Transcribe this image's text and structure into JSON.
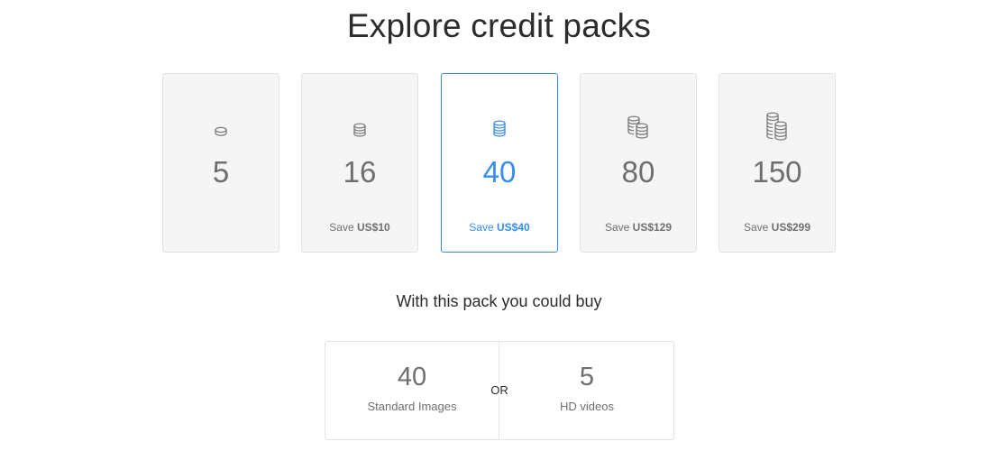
{
  "title": "Explore credit packs",
  "packs": [
    {
      "credits": "5",
      "save_prefix": "",
      "save_amount": "",
      "icon": "single-coin-icon",
      "selected": false
    },
    {
      "credits": "16",
      "save_prefix": "Save ",
      "save_amount": "US$10",
      "icon": "small-coin-stack-icon",
      "selected": false
    },
    {
      "credits": "40",
      "save_prefix": "Save ",
      "save_amount": "US$40",
      "icon": "coin-stack-icon",
      "selected": true
    },
    {
      "credits": "80",
      "save_prefix": "Save ",
      "save_amount": "US$129",
      "icon": "two-coin-stacks-icon",
      "selected": false
    },
    {
      "credits": "150",
      "save_prefix": "Save ",
      "save_amount": "US$299",
      "icon": "large-coin-stacks-icon",
      "selected": false
    }
  ],
  "colors": {
    "accent": "#378ef0",
    "card_bg": "#f5f5f5",
    "border": "#e3e3e3",
    "muted_text": "#6e6e6e"
  },
  "buy": {
    "heading": "With this pack you could buy",
    "left": {
      "value": "40",
      "label": "Standard Images"
    },
    "or_label": "OR",
    "right": {
      "value": "5",
      "label": "HD videos"
    }
  }
}
